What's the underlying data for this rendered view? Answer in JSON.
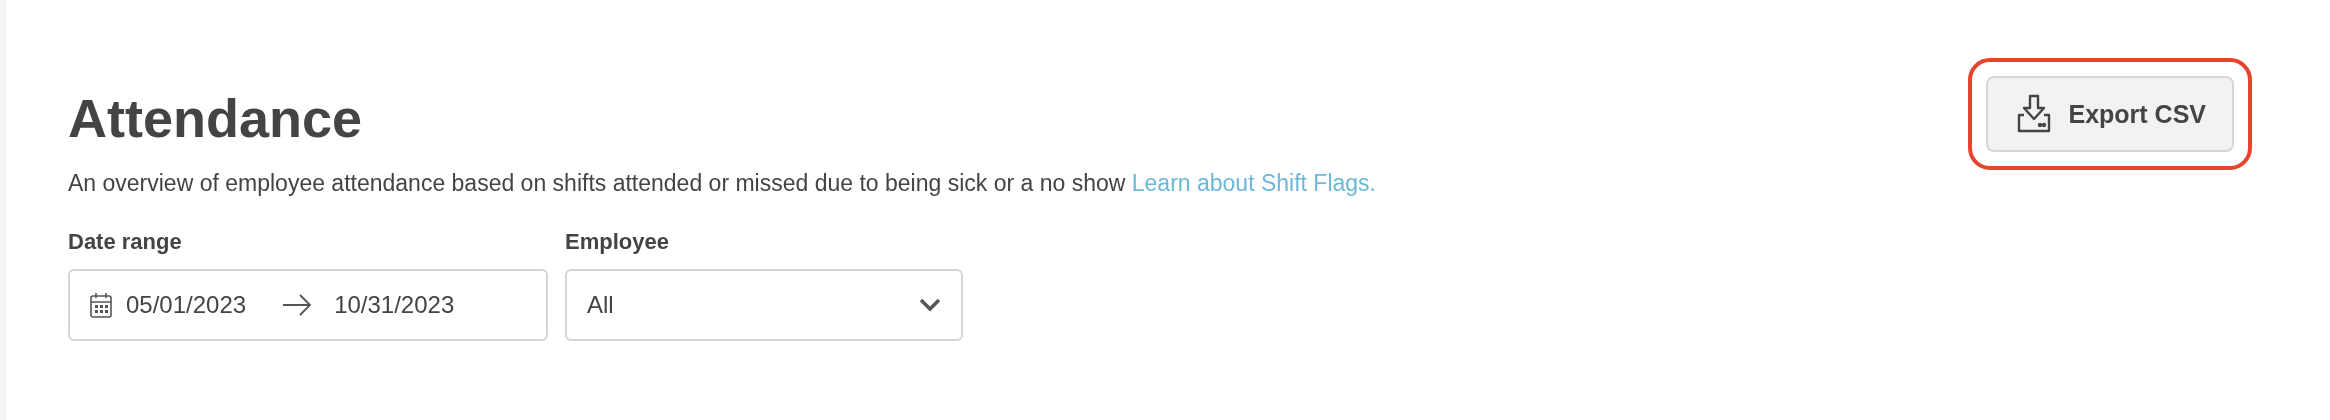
{
  "header": {
    "title": "Attendance",
    "description": "An overview of employee attendance based on shifts attended or missed due to being sick or a no show",
    "link": "Learn about Shift Flags."
  },
  "export_button": {
    "label": "Export CSV",
    "highlighted": true
  },
  "filters": [
    {
      "kind": "daterange",
      "label": "Date range",
      "start": "05/01/2023",
      "end": "10/31/2023"
    },
    {
      "kind": "select",
      "label": "Employee",
      "value": "All"
    }
  ]
}
